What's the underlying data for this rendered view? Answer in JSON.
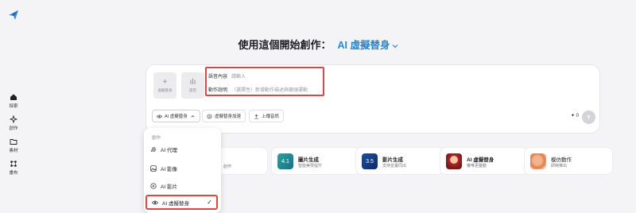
{
  "nav": {
    "items": [
      {
        "label": "探索",
        "icon": "home-icon"
      },
      {
        "label": "創作",
        "icon": "sparkle-icon"
      },
      {
        "label": "素材",
        "icon": "folder-icon"
      },
      {
        "label": "畫布",
        "icon": "canvas-icon"
      }
    ]
  },
  "heading": {
    "prefix": "使用這個開始創作：",
    "selection": "AI 虛擬替身"
  },
  "composer": {
    "slots": [
      {
        "glyph": "+",
        "label": "虛擬替身"
      },
      {
        "glyph": "ılı",
        "label": "語音"
      }
    ],
    "speech": {
      "label": "語音內容",
      "placeholder": "請輸入"
    },
    "action": {
      "label": "動作說明",
      "placeholder": "（選擇性）新增動作描述與鏡頭運動"
    },
    "chips": {
      "mode": "AI 虛擬替身",
      "accelerate": "虛擬替身加速",
      "upload": "上傳音訊"
    },
    "credits": "0"
  },
  "tiles": [
    {
      "title": "",
      "subtitle": "創作"
    },
    {
      "title": "圖片生成",
      "subtitle": "智能美學提升",
      "badge": "4.1"
    },
    {
      "title": "影片生成",
      "subtitle": "支持音畫同出",
      "badge": "3.5"
    },
    {
      "title": "AI 虛擬替身",
      "subtitle": "審唯更靈動"
    },
    {
      "title": "模仿動作",
      "subtitle": "即時推出"
    }
  ],
  "menu": {
    "section": "創作",
    "items": [
      {
        "label": "AI 代理",
        "icon": "agent-icon"
      },
      {
        "label": "AI 影像",
        "icon": "image-icon"
      },
      {
        "label": "AI 影片",
        "icon": "video-icon"
      },
      {
        "label": "AI 虛擬替身",
        "icon": "eye-icon",
        "selected": true
      }
    ]
  },
  "colors": {
    "accent": "#2b86c9",
    "highlight": "#e04545"
  }
}
